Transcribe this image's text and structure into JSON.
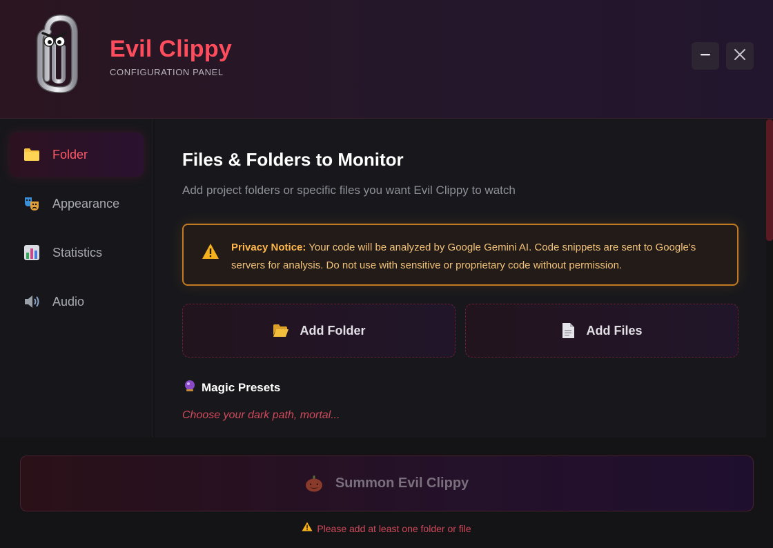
{
  "app": {
    "title": "Evil Clippy",
    "subtitle": "CONFIGURATION PANEL",
    "logo_icon": "evil-paperclip-icon"
  },
  "window_controls": {
    "minimize_icon": "minimize-icon",
    "close_icon": "close-icon"
  },
  "sidebar": {
    "items": [
      {
        "label": "Folder",
        "icon": "folder-icon",
        "active": true
      },
      {
        "label": "Appearance",
        "icon": "theater-masks-icon",
        "active": false
      },
      {
        "label": "Statistics",
        "icon": "bar-chart-icon",
        "active": false
      },
      {
        "label": "Audio",
        "icon": "speaker-icon",
        "active": false
      }
    ]
  },
  "main": {
    "title": "Files & Folders to Monitor",
    "description": "Add project folders or specific files you want Evil Clippy to watch",
    "notice": {
      "heading": "Privacy Notice:",
      "body": " Your code will be analyzed by Google Gemini AI. Code snippets are sent to Google's servers for analysis. Do not use with sensitive or proprietary code without permission.",
      "icon": "warning-icon"
    },
    "add_folder_label": "Add Folder",
    "add_files_label": "Add Files",
    "presets": {
      "heading": "Magic Presets",
      "icon": "crystal-ball-icon",
      "subtitle": "Choose your dark path, mortal..."
    }
  },
  "footer": {
    "summon_label": "Summon Evil Clippy",
    "summon_icon": "pumpkin-icon",
    "hint": "Please add at least one folder or file",
    "hint_icon": "warning-icon"
  },
  "colors": {
    "accent": "#ff4d5e",
    "warning": "#c27b22",
    "background": "#131316"
  }
}
